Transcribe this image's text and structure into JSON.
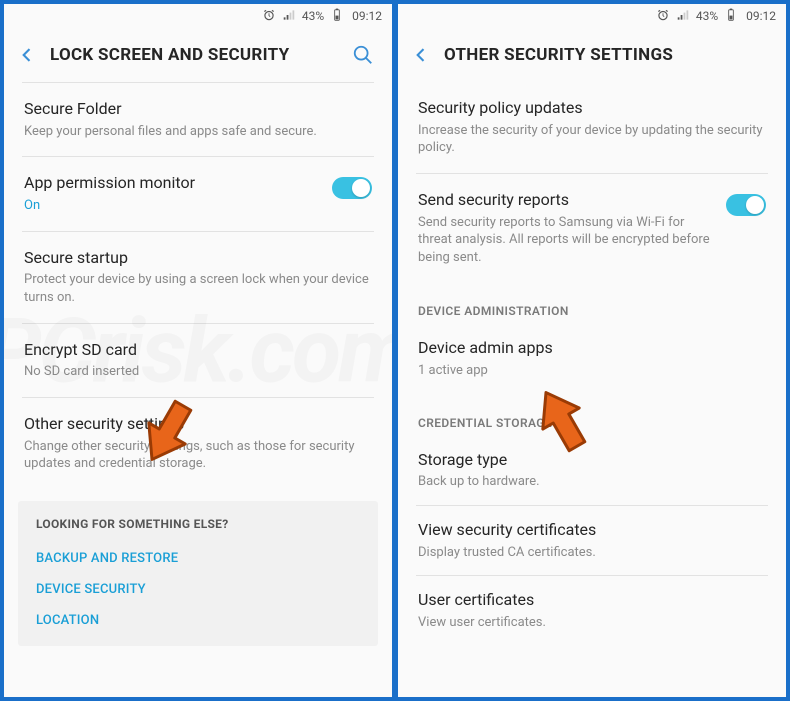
{
  "status": {
    "battery": "43%",
    "time": "09:12"
  },
  "left": {
    "title": "LOCK SCREEN AND SECURITY",
    "items": {
      "secureFolder": {
        "title": "Secure Folder",
        "sub": "Keep your personal files and apps safe and secure."
      },
      "appPerm": {
        "title": "App permission monitor",
        "sub": "On"
      },
      "secureStartup": {
        "title": "Secure startup",
        "sub": "Protect your device by using a screen lock when your device turns on."
      },
      "encryptSd": {
        "title": "Encrypt SD card",
        "sub": "No SD card inserted"
      },
      "otherSec": {
        "title": "Other security settings",
        "sub": "Change other security settings, such as those for security updates and credential storage."
      }
    },
    "footer": {
      "head": "LOOKING FOR SOMETHING ELSE?",
      "links": [
        "BACKUP AND RESTORE",
        "DEVICE SECURITY",
        "LOCATION"
      ]
    }
  },
  "right": {
    "title": "OTHER SECURITY SETTINGS",
    "items": {
      "policy": {
        "title": "Security policy updates",
        "sub": "Increase the security of your device by updating the security policy."
      },
      "reports": {
        "title": "Send security reports",
        "sub": "Send security reports to Samsung via Wi-Fi for threat analysis. All reports will be encrypted before being sent."
      }
    },
    "sections": {
      "devAdminHead": "DEVICE ADMINISTRATION",
      "devAdmin": {
        "title": "Device admin apps",
        "sub": "1 active app"
      },
      "credHead": "CREDENTIAL STORAGE",
      "storage": {
        "title": "Storage type",
        "sub": "Back up to hardware."
      },
      "viewCert": {
        "title": "View security certificates",
        "sub": "Display trusted CA certificates."
      },
      "userCert": {
        "title": "User certificates",
        "sub": "View user certificates."
      }
    }
  }
}
